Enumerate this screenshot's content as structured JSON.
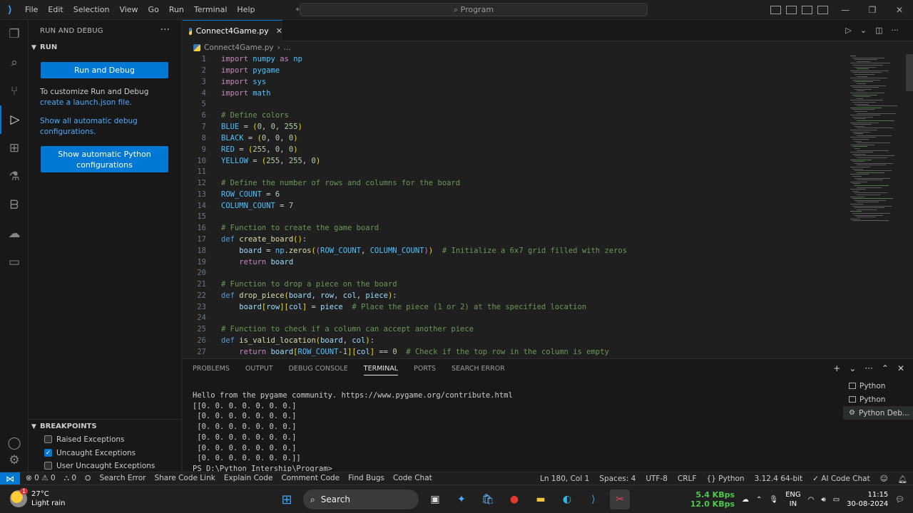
{
  "titlebar": {
    "menu": [
      "File",
      "Edit",
      "Selection",
      "View",
      "Go",
      "Run",
      "Terminal",
      "Help"
    ],
    "command_center": "Program"
  },
  "sidebar": {
    "header": "RUN AND DEBUG",
    "run_section": "RUN",
    "run_debug_button": "Run and Debug",
    "customize_text": "To customize Run and Debug",
    "customize_link": "create a launch.json file.",
    "show_all_link": "Show all automatic debug configurations.",
    "python_button": "Show automatic Python configurations",
    "breakpoints_section": "BREAKPOINTS",
    "breakpoints": [
      {
        "label": "Raised Exceptions",
        "checked": false
      },
      {
        "label": "Uncaught Exceptions",
        "checked": true
      },
      {
        "label": "User Uncaught Exceptions",
        "checked": false
      }
    ]
  },
  "editor": {
    "tab_label": "Connect4Game.py",
    "breadcrumb_file": "Connect4Game.py",
    "breadcrumb_more": "...",
    "line_numbers": [
      "1",
      "2",
      "3",
      "4",
      "5",
      "6",
      "7",
      "8",
      "9",
      "10",
      "11",
      "12",
      "13",
      "14",
      "15",
      "16",
      "17",
      "18",
      "19",
      "20",
      "21",
      "22",
      "23",
      "24",
      "25",
      "26",
      "27"
    ]
  },
  "panel": {
    "tabs": [
      "PROBLEMS",
      "OUTPUT",
      "DEBUG CONSOLE",
      "TERMINAL",
      "PORTS",
      "SEARCH ERROR"
    ],
    "active_tab": "TERMINAL",
    "terminal_lines": [
      "Hello from the pygame community. https://www.pygame.org/contribute.html",
      "[[0. 0. 0. 0. 0. 0. 0.]",
      " [0. 0. 0. 0. 0. 0. 0.]",
      " [0. 0. 0. 0. 0. 0. 0.]",
      " [0. 0. 0. 0. 0. 0. 0.]",
      " [0. 0. 0. 0. 0. 0. 0.]",
      " [0. 0. 0. 0. 0. 0. 0.]]",
      "PS D:\\Python Intership\\Program>"
    ],
    "terminals": [
      "Python",
      "Python",
      "Python Deb..."
    ]
  },
  "statusbar": {
    "errors": "0",
    "warnings": "0",
    "ports": "0",
    "left_items": [
      "Search Error",
      "Share Code Link",
      "Explain Code",
      "Comment Code",
      "Find Bugs",
      "Code Chat"
    ],
    "position": "Ln 180, Col 1",
    "spaces": "Spaces: 4",
    "encoding": "UTF-8",
    "eol": "CRLF",
    "language": "Python",
    "interpreter": "3.12.4 64-bit",
    "ai_chat": "AI Code Chat"
  },
  "taskbar": {
    "temperature": "27°C",
    "weather": "Light rain",
    "badge": "1",
    "search": "Search",
    "net_up": "5.4 KBps",
    "net_down": "12.0 KBps",
    "lang_top": "ENG",
    "lang_bottom": "IN",
    "time": "11:15",
    "date": "30-08-2024"
  },
  "colors": {
    "accent": "#0078d4",
    "editor_bg": "#1f1f1f",
    "sidebar_bg": "#181818"
  }
}
